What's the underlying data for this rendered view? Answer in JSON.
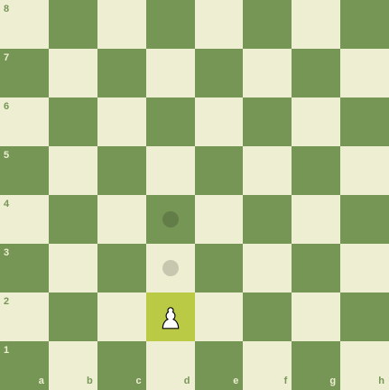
{
  "board": {
    "light_color": "#eeeed2",
    "dark_color": "#769656",
    "selected_color": "#baca44",
    "ranks": [
      "8",
      "7",
      "6",
      "5",
      "4",
      "3",
      "2",
      "1"
    ],
    "files": [
      "a",
      "b",
      "c",
      "d",
      "e",
      "f",
      "g",
      "h"
    ],
    "selected_square": "d2",
    "legal_move_hints": [
      "d3",
      "d4"
    ],
    "pieces": [
      {
        "square": "d2",
        "piece": "white-pawn"
      }
    ]
  }
}
